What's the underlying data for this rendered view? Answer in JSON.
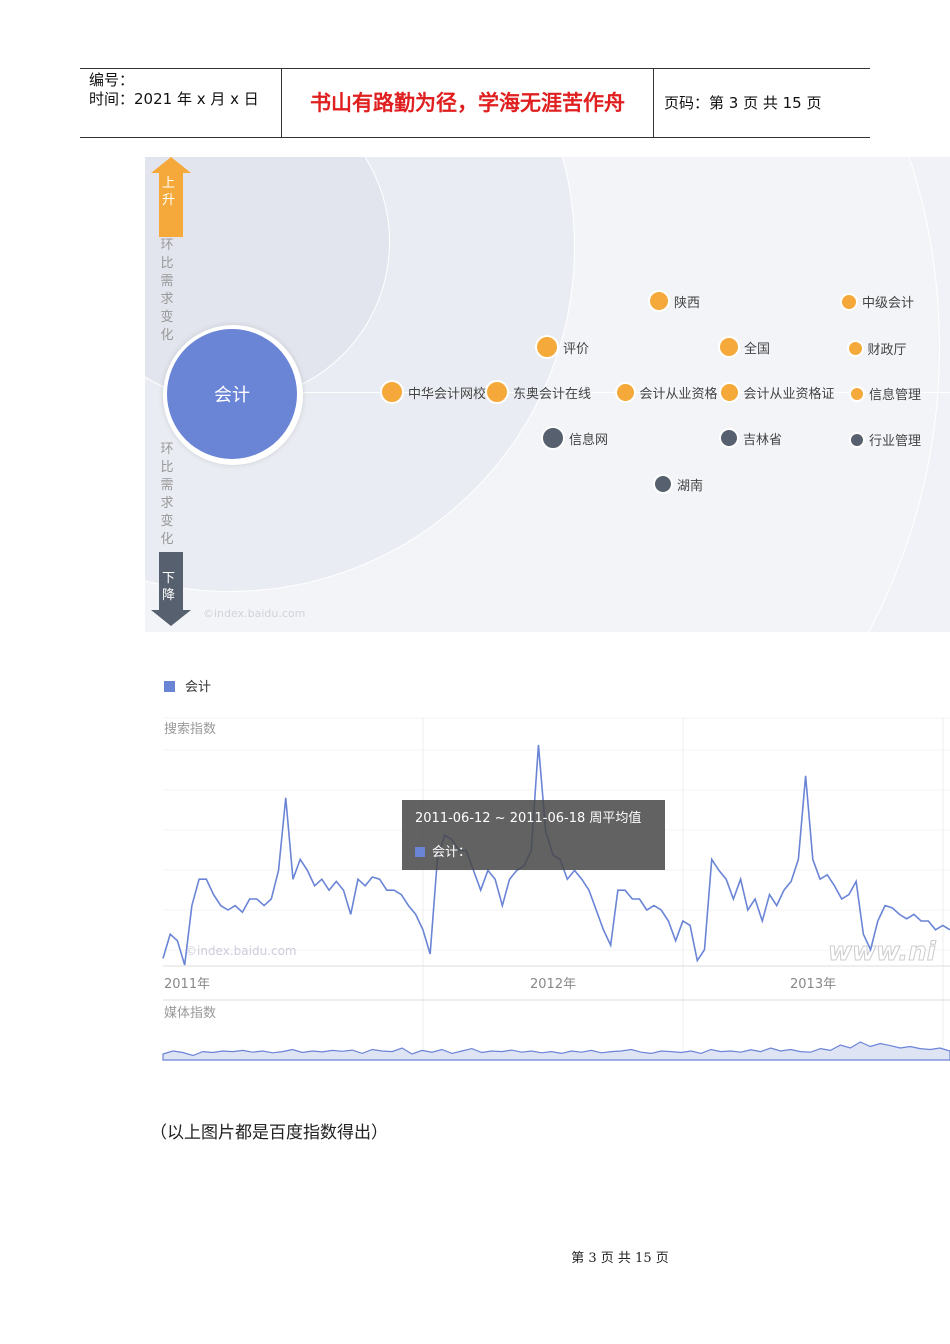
{
  "header": {
    "number_label": "编号：",
    "time_label": "时间：2021 年 x 月 x 日",
    "motto": "书山有路勤为径，学海无涯苦作舟",
    "page_info": "页码：第 3 页  共 15 页"
  },
  "radial": {
    "center": "会计",
    "up_label": "上升",
    "down_label": "下降",
    "up_side_text": "环比需求变化",
    "down_side_text": "环比需求变化",
    "watermark": "©index.baidu.com",
    "colors": {
      "rising": "#f5a93a",
      "falling": "#56606e",
      "center": "#6a84d6"
    },
    "nodes": [
      {
        "label": "陕西",
        "trend": "up"
      },
      {
        "label": "中级会计",
        "trend": "up"
      },
      {
        "label": "评价",
        "trend": "up"
      },
      {
        "label": "全国",
        "trend": "up"
      },
      {
        "label": "财政厅",
        "trend": "up"
      },
      {
        "label": "中华会计网校",
        "trend": "up"
      },
      {
        "label": "东奥会计在线",
        "trend": "up"
      },
      {
        "label": "会计从业资格",
        "trend": "up"
      },
      {
        "label": "会计从业资格证",
        "trend": "up"
      },
      {
        "label": "信息管理",
        "trend": "up"
      },
      {
        "label": "信息网",
        "trend": "down"
      },
      {
        "label": "吉林省",
        "trend": "down"
      },
      {
        "label": "行业管理",
        "trend": "down"
      },
      {
        "label": "湖南",
        "trend": "down"
      }
    ]
  },
  "chart_data": {
    "type": "line",
    "legend": [
      "会计"
    ],
    "search_label": "搜索指数",
    "media_label": "媒体指数",
    "x_ticks": [
      "2011年",
      "2012年",
      "2013年"
    ],
    "tooltip": {
      "title": "2011-06-12 ~ 2011-06-18 周平均值",
      "series": "会计："
    },
    "watermark": "©index.baidu.com",
    "watermark2": "www.ni",
    "color": "#6a84d6",
    "search_values": [
      3,
      14,
      11,
      0,
      27,
      39,
      39,
      32,
      27,
      25,
      27,
      24,
      30,
      30,
      27,
      30,
      43,
      76,
      39,
      48,
      43,
      36,
      39,
      34,
      38,
      34,
      23,
      39,
      36,
      40,
      39,
      34,
      34,
      32,
      27,
      23,
      16,
      5,
      48,
      59,
      57,
      52,
      52,
      43,
      34,
      43,
      39,
      27,
      39,
      43,
      45,
      52,
      100,
      61,
      50,
      48,
      39,
      43,
      39,
      34,
      25,
      16,
      9,
      34,
      34,
      30,
      30,
      25,
      27,
      25,
      20,
      11,
      20,
      18,
      2,
      7,
      48,
      43,
      39,
      30,
      39,
      25,
      30,
      20,
      32,
      27,
      34,
      38,
      48,
      86,
      48,
      39,
      41,
      36,
      30,
      32,
      38,
      14,
      7,
      20,
      27,
      26,
      23,
      21,
      23,
      20,
      20,
      16,
      18,
      16
    ],
    "media_values": [
      20,
      30,
      25,
      15,
      28,
      25,
      30,
      28,
      32,
      26,
      30,
      24,
      28,
      35,
      25,
      30,
      27,
      32,
      29,
      33,
      22,
      35,
      30,
      28,
      40,
      20,
      32,
      26,
      35,
      22,
      30,
      38,
      25,
      30,
      28,
      33,
      26,
      30,
      24,
      28,
      22,
      30,
      26,
      32,
      24,
      28,
      30,
      35,
      26,
      22,
      30,
      28,
      25,
      30,
      22,
      35,
      28,
      30,
      26,
      34,
      28,
      40,
      30,
      35,
      28,
      26,
      38,
      32,
      50,
      40,
      60,
      45,
      55,
      48,
      40,
      45,
      38,
      35,
      40,
      30
    ]
  },
  "footer": {
    "caption": "（以上图片都是百度指数得出）",
    "page": "第 3 页 共 15 页"
  }
}
